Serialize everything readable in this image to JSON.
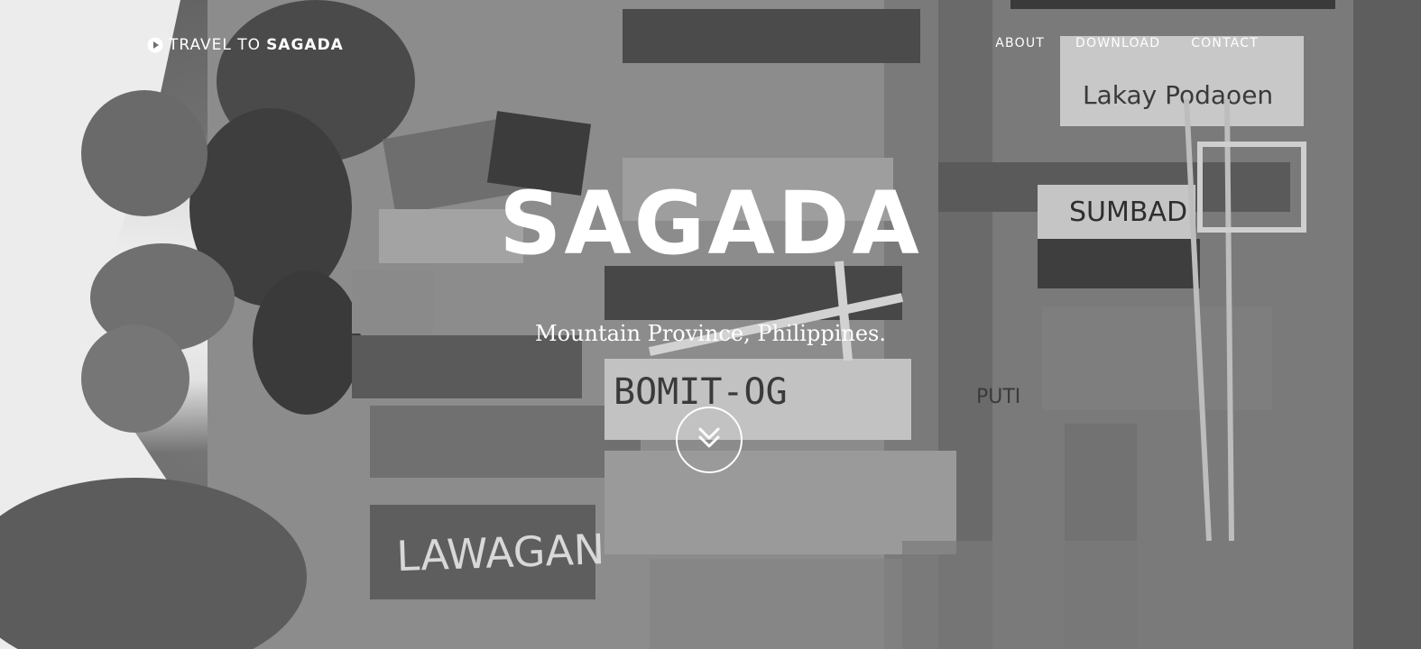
{
  "nav": {
    "brand_light": "TRAVEL TO ",
    "brand_bold": "SAGADA",
    "brand_icon": "play-circle-icon",
    "links": [
      {
        "label": "ABOUT"
      },
      {
        "label": "DOWNLOAD"
      },
      {
        "label": "CONTACT"
      }
    ]
  },
  "hero": {
    "title": "SAGADA",
    "subtitle": "Mountain Province, Philippines.",
    "scroll_icon": "double-chevron-down-icon",
    "background": {
      "coffin_labels": [
        "Lakay Podaoen",
        "SUMBAD",
        "BOMIT-OG",
        "LAWAGAN",
        "PUTI"
      ]
    }
  },
  "colors": {
    "text": "#ffffff",
    "photo_tone": "grayscale"
  }
}
